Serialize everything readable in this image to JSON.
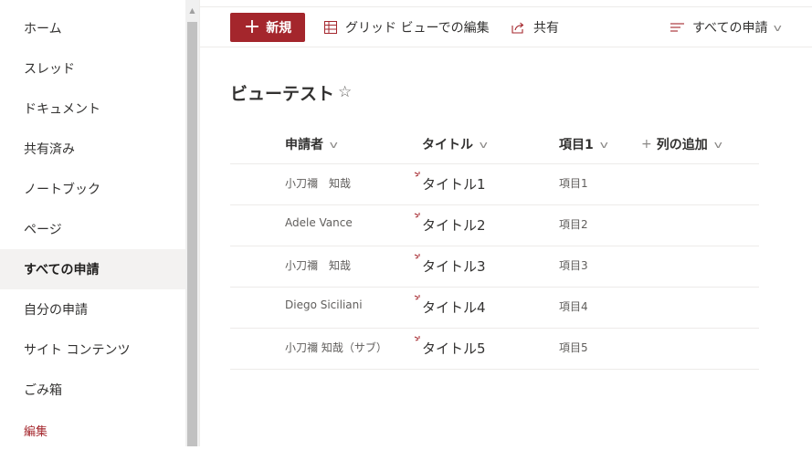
{
  "sidebar": {
    "items": [
      {
        "label": "ホーム"
      },
      {
        "label": "スレッド"
      },
      {
        "label": "ドキュメント"
      },
      {
        "label": "共有済み"
      },
      {
        "label": "ノートブック"
      },
      {
        "label": "ページ"
      },
      {
        "label": "すべての申請"
      },
      {
        "label": "自分の申請"
      },
      {
        "label": "サイト コンテンツ"
      },
      {
        "label": "ごみ箱"
      },
      {
        "label": "編集"
      }
    ],
    "selected": "すべての申請"
  },
  "commandbar": {
    "new_label": "新規",
    "grid_label": "グリッド ビューでの編集",
    "share_label": "共有",
    "view_label": "すべての申請"
  },
  "page": {
    "title": "ビューテスト"
  },
  "table": {
    "columns": [
      {
        "label": "申請者"
      },
      {
        "label": "タイトル"
      },
      {
        "label": "項目1"
      },
      {
        "label": "列の追加"
      }
    ],
    "rows": [
      {
        "requester": "小刀禰　知哉",
        "title": "タイトル1",
        "item": "項目1"
      },
      {
        "requester": "Adele Vance",
        "title": "タイトル2",
        "item": "項目2"
      },
      {
        "requester": "小刀禰　知哉",
        "title": "タイトル3",
        "item": "項目3"
      },
      {
        "requester": "Diego Siciliani",
        "title": "タイトル4",
        "item": "項目4"
      },
      {
        "requester": "小刀禰 知哉（サブ）",
        "title": "タイトル5",
        "item": "項目5"
      }
    ]
  },
  "colors": {
    "accent": "#a4262c",
    "selected_bg": "#f3f2f1"
  }
}
